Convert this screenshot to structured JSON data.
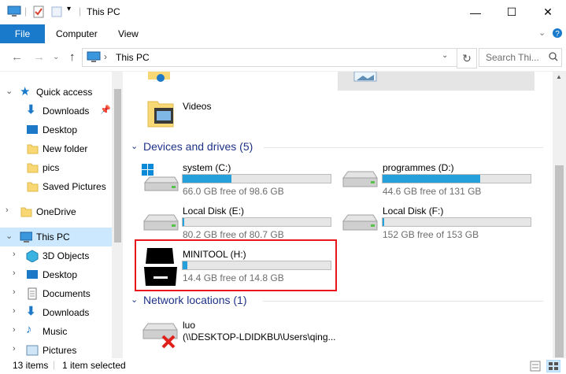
{
  "window": {
    "title": "This PC",
    "buttons": {
      "minimize": "—",
      "maximize": "☐",
      "close": "✕"
    }
  },
  "ribbon": {
    "tabs": [
      "File",
      "Computer",
      "View"
    ],
    "help": "?"
  },
  "address": {
    "path": "This PC",
    "search_placeholder": "Search Thi..."
  },
  "nav": {
    "quick_access": "Quick access",
    "quick_items": [
      "Downloads",
      "Desktop",
      "New folder",
      "pics",
      "Saved Pictures"
    ],
    "onedrive": "OneDrive",
    "this_pc": "This PC",
    "pc_items": [
      "3D Objects",
      "Desktop",
      "Documents",
      "Downloads",
      "Music",
      "Pictures"
    ]
  },
  "content": {
    "videos_label": "Videos",
    "devices_header": "Devices and drives (5)",
    "drives": [
      {
        "name": "system (C:)",
        "free": "66.0 GB free of 98.6 GB",
        "used_fraction": 0.33
      },
      {
        "name": "programmes (D:)",
        "free": "44.6 GB free of 131 GB",
        "used_fraction": 0.66
      },
      {
        "name": "Local Disk (E:)",
        "free": "80.2 GB free of 80.7 GB",
        "used_fraction": 0.01
      },
      {
        "name": "Local Disk (F:)",
        "free": "152 GB free of 153 GB",
        "used_fraction": 0.01
      },
      {
        "name": "MINITOOL (H:)",
        "free": "14.4 GB free of 14.8 GB",
        "used_fraction": 0.03
      }
    ],
    "network_header": "Network locations (1)",
    "network": {
      "name": "luo",
      "path": "(\\\\DESKTOP-LDIDKBU\\Users\\qing..."
    }
  },
  "status": {
    "count": "13 items",
    "selection": "1 item selected"
  },
  "colors": {
    "accent": "#1979ca",
    "bar_fill": "#26a0da",
    "highlight": "#e8151b",
    "header_text": "#1e3287"
  }
}
